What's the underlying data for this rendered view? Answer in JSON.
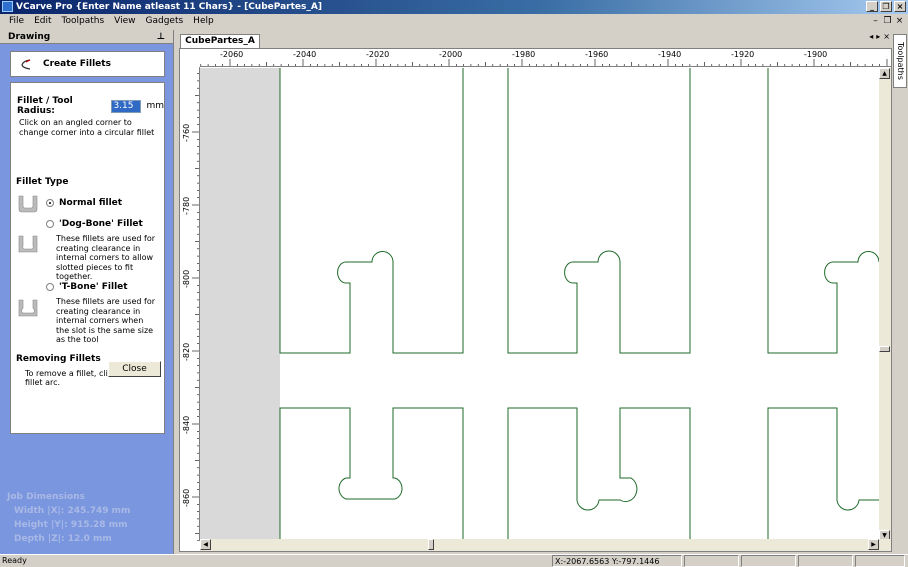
{
  "window": {
    "title": "VCarve Pro {Enter Name atleast 11 Chars} - [CubePartes_A]"
  },
  "menu": {
    "items": [
      "File",
      "Edit",
      "Toolpaths",
      "View",
      "Gadgets",
      "Help"
    ]
  },
  "panel": {
    "header": "Drawing",
    "tool_title": "Create Fillets",
    "radius_label": "Fillet / Tool Radius:",
    "radius_value": "3.15",
    "radius_unit": "mm",
    "help_text": "Click on an angled corner to change corner into a circular fillet",
    "fillet_type_title": "Fillet Type",
    "options": [
      {
        "label": "Normal fillet",
        "selected": true,
        "desc": ""
      },
      {
        "label": "'Dog-Bone' Fillet",
        "selected": false,
        "desc": "These fillets are used for creating clearance in internal corners to allow slotted pieces to fit together."
      },
      {
        "label": "'T-Bone' Fillet",
        "selected": false,
        "desc": "These fillets are used for creating clearance in internal corners when the slot is the same size as the tool"
      }
    ],
    "removing_title": "Removing Fillets",
    "removing_text": "To remove a fillet, click on the fillet arc.",
    "close_label": "Close",
    "job_dims": {
      "title": "Job Dimensions",
      "width": "Width  |X|: 245.749 mm",
      "height": "Height |Y|: 915.28 mm",
      "depth": "Depth  |Z|: 12.0 mm"
    }
  },
  "document": {
    "tab_label": "CubePartes_A",
    "ruler_top_labels": [
      "-2060",
      "-2040",
      "-2020",
      "-2000",
      "-1980",
      "-1960",
      "-1940",
      "-1920",
      "-1900"
    ],
    "ruler_left_labels": [
      "-760",
      "-780",
      "-800",
      "-820",
      "-840",
      "-860"
    ]
  },
  "side_tab": "Toolpaths",
  "status": {
    "ready": "Ready",
    "coords": "X:-2067.6563 Y:-797.1446"
  }
}
